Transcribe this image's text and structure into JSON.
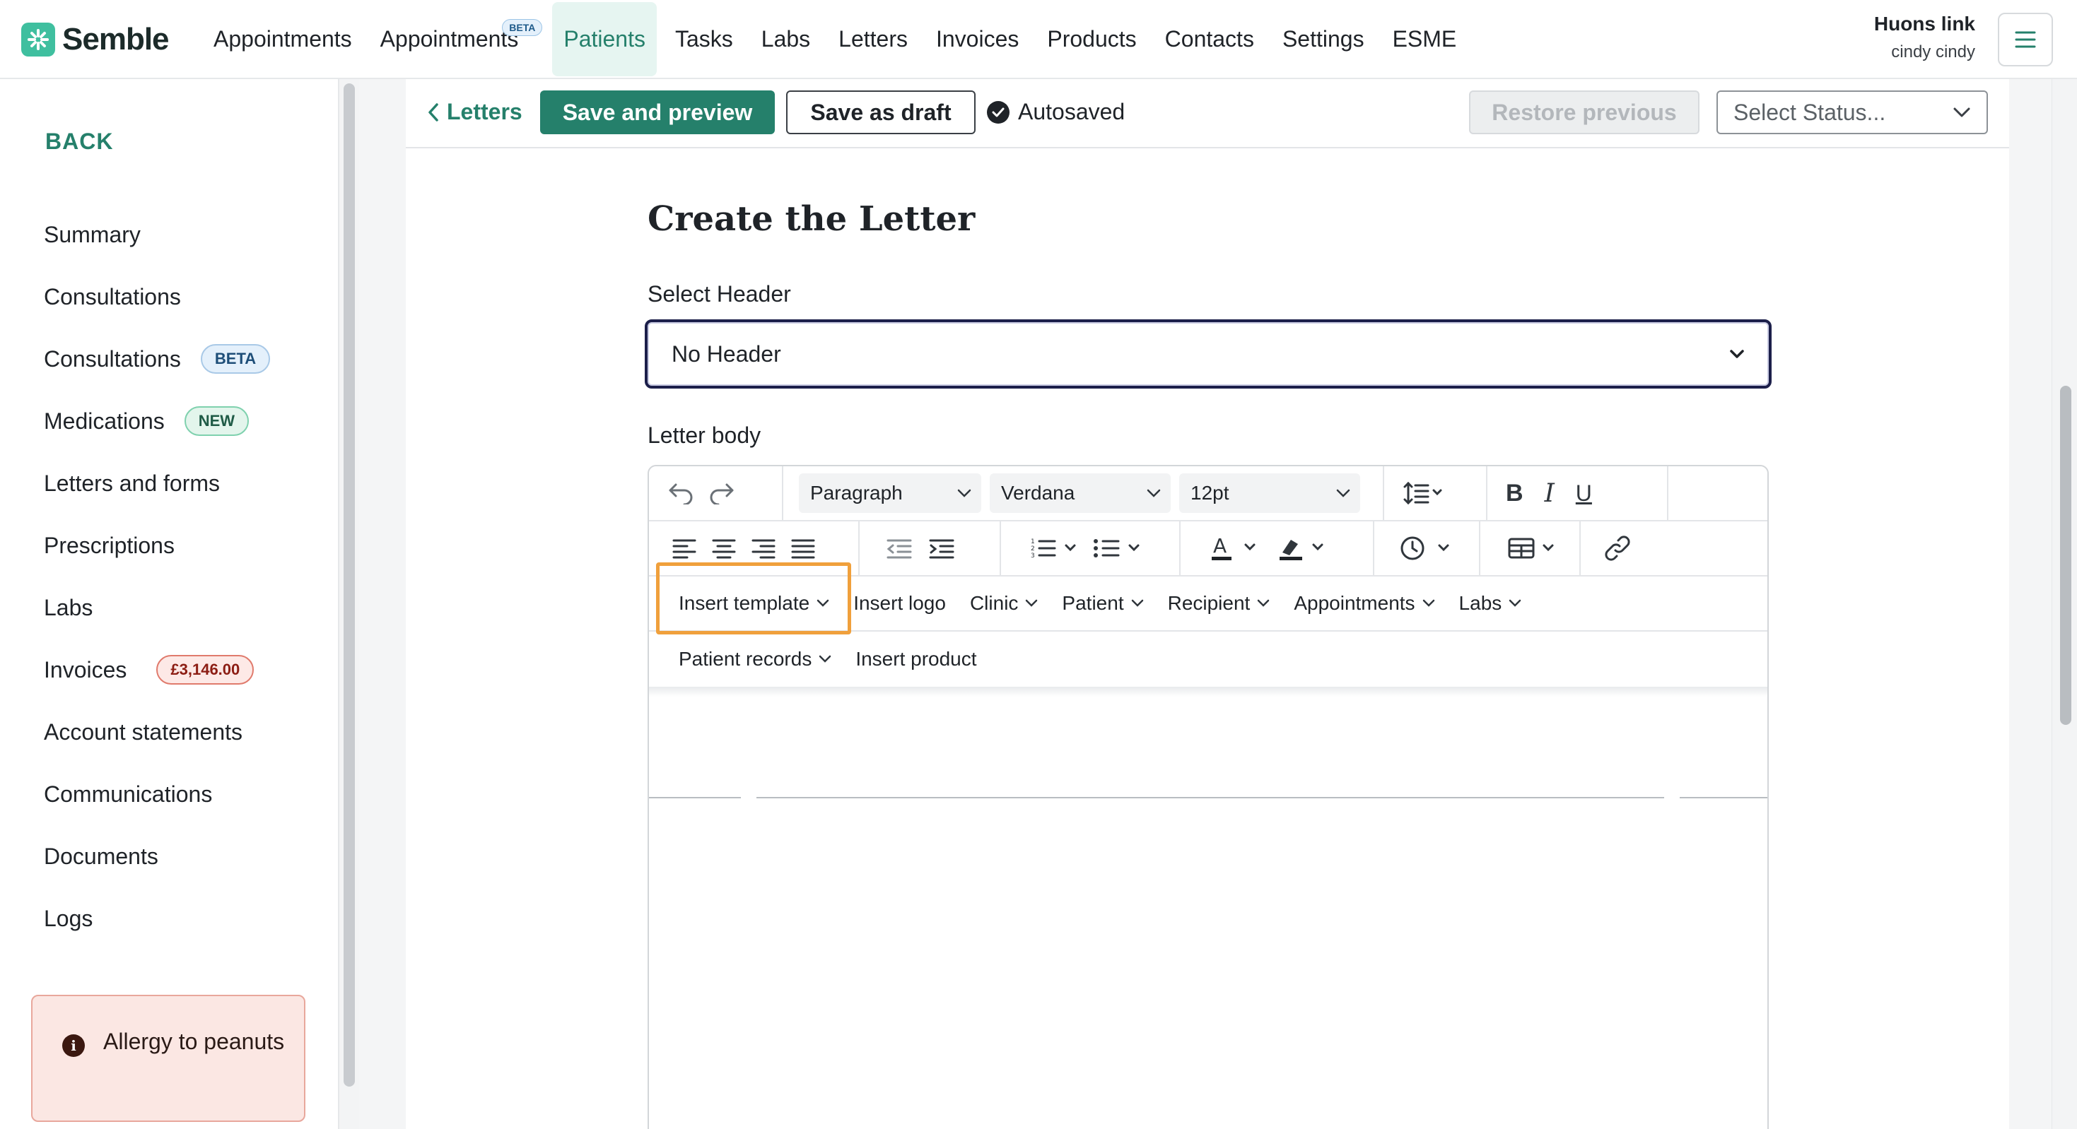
{
  "app": {
    "brand": "Semble",
    "accent": "#25806b",
    "logo_color": "#3fbf9f"
  },
  "topnav": {
    "items": [
      {
        "label": "Appointments"
      },
      {
        "label": "Appointments",
        "badge": "BETA"
      },
      {
        "label": "Patients",
        "active": true
      },
      {
        "label": "Tasks"
      },
      {
        "label": "Labs"
      },
      {
        "label": "Letters"
      },
      {
        "label": "Invoices"
      },
      {
        "label": "Products"
      },
      {
        "label": "Contacts"
      },
      {
        "label": "Settings"
      },
      {
        "label": "ESME"
      }
    ],
    "user_name": "Huons link",
    "user_sub": "cindy cindy",
    "menu_icon": "hamburger-icon"
  },
  "sidebar": {
    "back_label": "BACK",
    "items": [
      {
        "label": "Summary"
      },
      {
        "label": "Consultations"
      },
      {
        "label": "Consultations",
        "badge": "BETA"
      },
      {
        "label": "Medications",
        "badge": "NEW"
      },
      {
        "label": "Letters and forms"
      },
      {
        "label": "Prescriptions"
      },
      {
        "label": "Labs"
      },
      {
        "label": "Invoices",
        "badge": "£3,146.00"
      },
      {
        "label": "Account statements"
      },
      {
        "label": "Communications"
      },
      {
        "label": "Documents"
      },
      {
        "label": "Logs"
      }
    ],
    "alert": {
      "icon": "info-icon",
      "text": "Allergy to peanuts"
    }
  },
  "toolbar": {
    "back_label": "Letters",
    "save_preview_label": "Save and preview",
    "save_draft_label": "Save as draft",
    "autosaved_label": "Autosaved",
    "restore_label": "Restore previous",
    "status_placeholder": "Select Status..."
  },
  "form": {
    "title": "Create the Letter",
    "header_label": "Select Header",
    "header_value": "No Header",
    "body_label": "Letter body"
  },
  "editor": {
    "block_format": "Paragraph",
    "font_family": "Verdana",
    "font_size": "12pt",
    "menus": {
      "insert_template": "Insert template",
      "insert_logo": "Insert logo",
      "clinic": "Clinic",
      "patient": "Patient",
      "recipient": "Recipient",
      "appointments": "Appointments",
      "labs": "Labs",
      "patient_records": "Patient records",
      "insert_product": "Insert product"
    },
    "highlight_color": "#f0a03c"
  }
}
